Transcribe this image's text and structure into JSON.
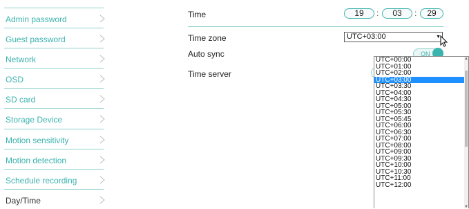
{
  "sidebar": {
    "items": [
      {
        "label": "Admin password"
      },
      {
        "label": "Guest password"
      },
      {
        "label": "Network"
      },
      {
        "label": "OSD"
      },
      {
        "label": "SD card"
      },
      {
        "label": "Storage Device"
      },
      {
        "label": "Motion sensitivity"
      },
      {
        "label": "Motion detection"
      },
      {
        "label": "Schedule recording"
      },
      {
        "label": "Day/Time",
        "active": true
      }
    ]
  },
  "main": {
    "time": {
      "label": "Time",
      "hour": "19",
      "minute": "03",
      "second": "29",
      "separator": ":"
    },
    "timezone": {
      "label": "Time zone",
      "selected": "UTC+03:00"
    },
    "autosync": {
      "label": "Auto sync",
      "state": "ON"
    },
    "server": {
      "label": "Time server"
    }
  },
  "dropdown": {
    "options": [
      "UTC+00:00",
      "UTC+01:00",
      "UTC+02:00",
      "UTC+03:00",
      "UTC+03:30",
      "UTC+04:00",
      "UTC+04:30",
      "UTC+05:00",
      "UTC+05:30",
      "UTC+05:45",
      "UTC+06:00",
      "UTC+06:30",
      "UTC+07:00",
      "UTC+08:00",
      "UTC+09:00",
      "UTC+09:30",
      "UTC+10:00",
      "UTC+10:30",
      "UTC+11:00",
      "UTC+12:00"
    ],
    "selected_index": 3
  },
  "colors": {
    "accent": "#3bb3ae",
    "separator": "#8fd0cc",
    "selection": "#1e90ff"
  },
  "icons": {
    "nav_chevron": "chevron-right-icon",
    "select_arrow": "caret-down-icon",
    "pointer": "mouse-cursor-icon"
  }
}
